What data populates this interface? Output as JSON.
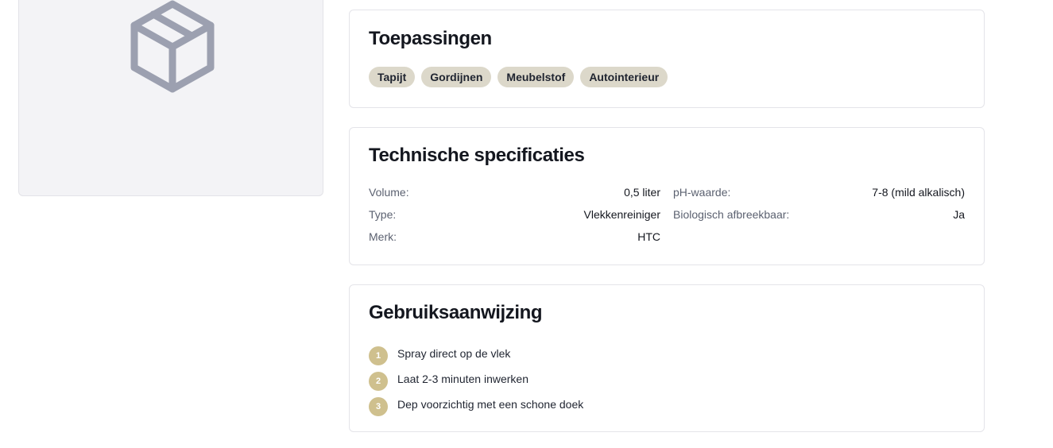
{
  "product_image": {
    "icon": "package-box-icon",
    "icon_color": "#9ca0b0",
    "background": "#f3f3f6"
  },
  "applications": {
    "title": "Toepassingen",
    "tags": [
      "Tapijt",
      "Gordijnen",
      "Meubelstof",
      "Autointerieur"
    ]
  },
  "specs": {
    "title": "Technische specificaties",
    "left": [
      {
        "label": "Volume:",
        "value": "0,5 liter"
      },
      {
        "label": "Type:",
        "value": "Vlekkenreiniger"
      },
      {
        "label": "Merk:",
        "value": "HTC"
      }
    ],
    "right": [
      {
        "label": "pH-waarde:",
        "value": "7-8 (mild alkalisch)"
      },
      {
        "label": "Biologisch afbreekbaar:",
        "value": "Ja"
      }
    ]
  },
  "usage": {
    "title": "Gebruiksaanwijzing",
    "steps": [
      {
        "number": "1",
        "text": "Spray direct op de vlek"
      },
      {
        "number": "2",
        "text": "Laat 2-3 minuten inwerken"
      },
      {
        "number": "3",
        "text": "Dep voorzichtig met een schone doek"
      }
    ]
  },
  "colors": {
    "tag_background": "#dcd8ca",
    "step_badge": "#cfc08e",
    "card_border": "#e4e4e9"
  }
}
